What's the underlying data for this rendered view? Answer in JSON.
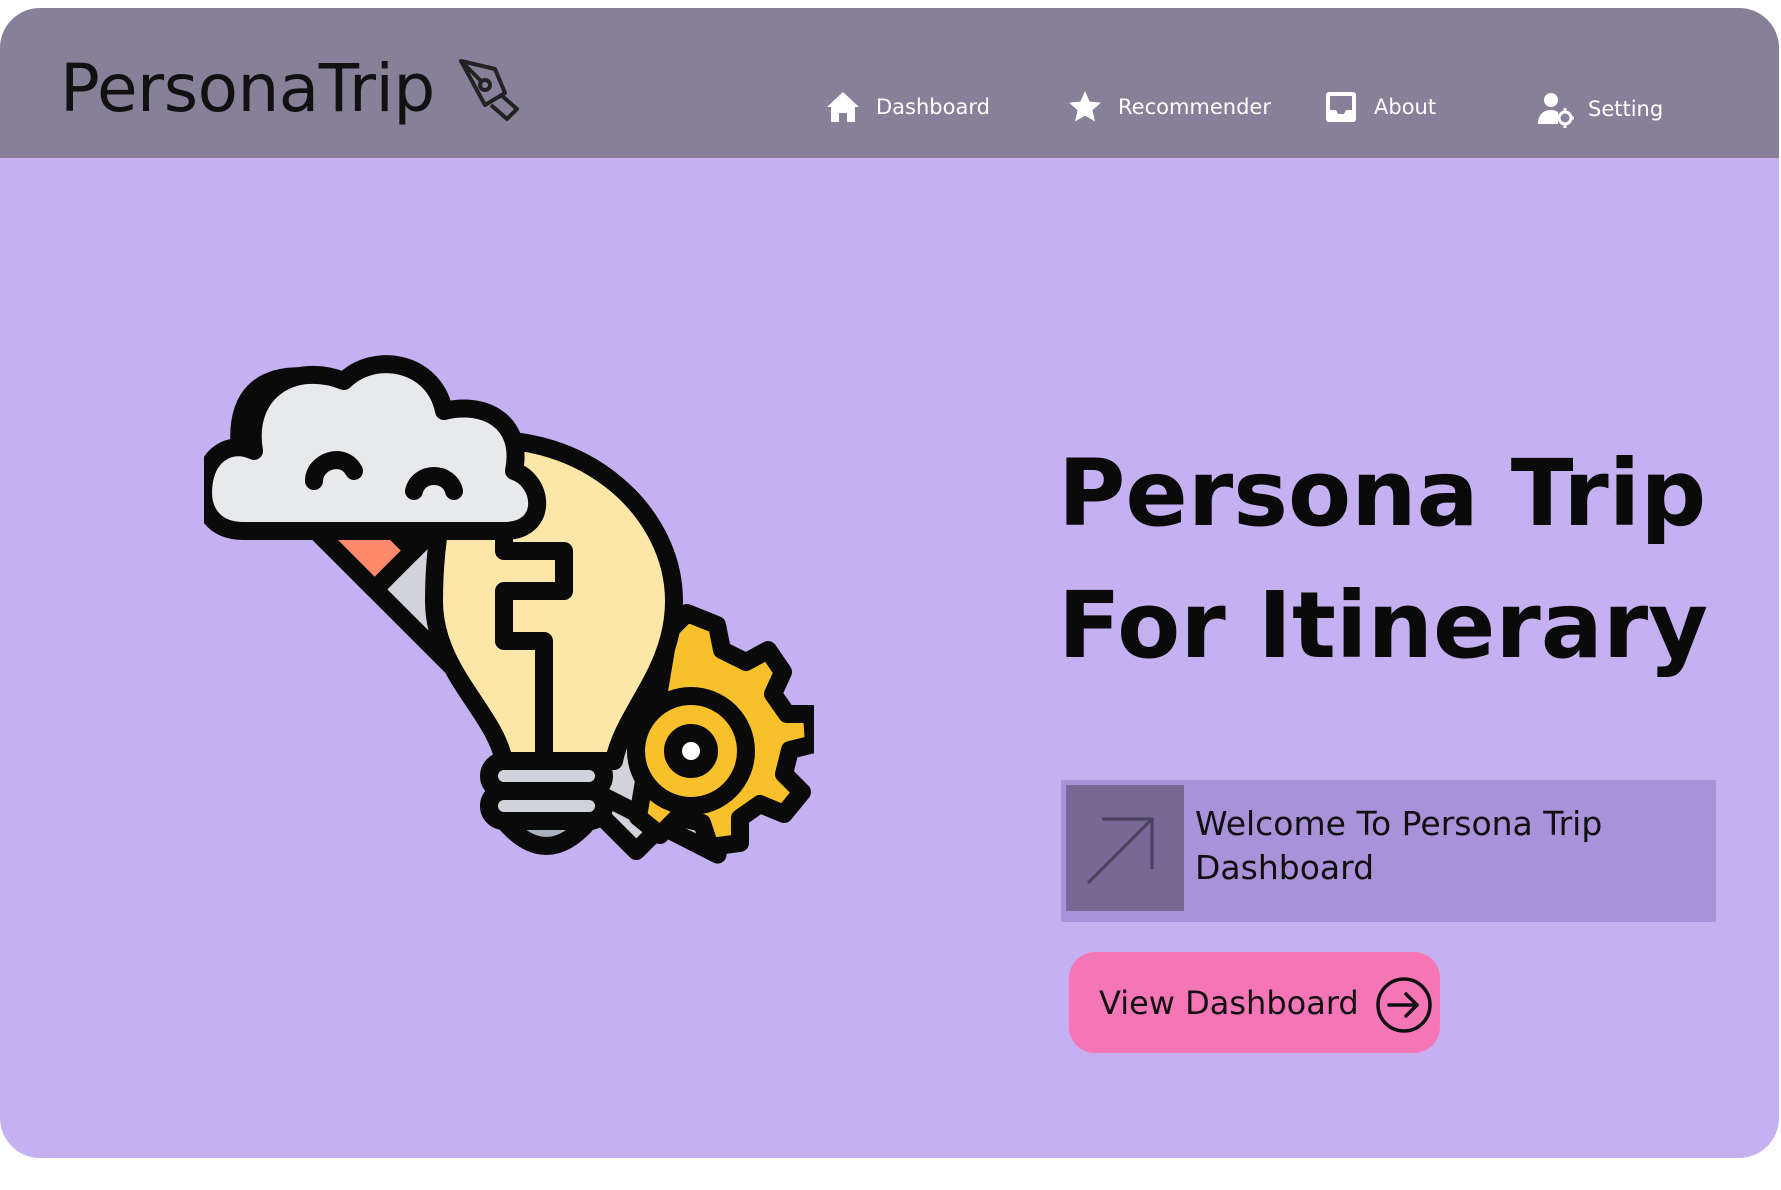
{
  "brand": {
    "name": "PersonaTrip",
    "icon": "pen-nib-icon"
  },
  "nav": {
    "items": [
      {
        "label": "Dashboard",
        "icon": "home-icon"
      },
      {
        "label": "Recommender",
        "icon": "star-icon"
      },
      {
        "label": "About",
        "icon": "inbox-icon"
      },
      {
        "label": "Setting",
        "icon": "user-gear-icon"
      }
    ]
  },
  "hero": {
    "title_line1": "Persona Trip",
    "title_line2": "For Itinerary",
    "illustration": "idea-bulb-pencil-cloud-gear-illustration",
    "welcome_text": "Welcome To Persona Trip Dashboard",
    "welcome_icon": "arrow-up-right-icon",
    "button_label": "View Dashboard",
    "button_icon": "arrow-right-circle-icon"
  },
  "colors": {
    "navbar": "#888099",
    "background": "#c5b1f1",
    "welcome_box": "#a892da",
    "welcome_tile": "#776996",
    "button": "#f576b6"
  }
}
